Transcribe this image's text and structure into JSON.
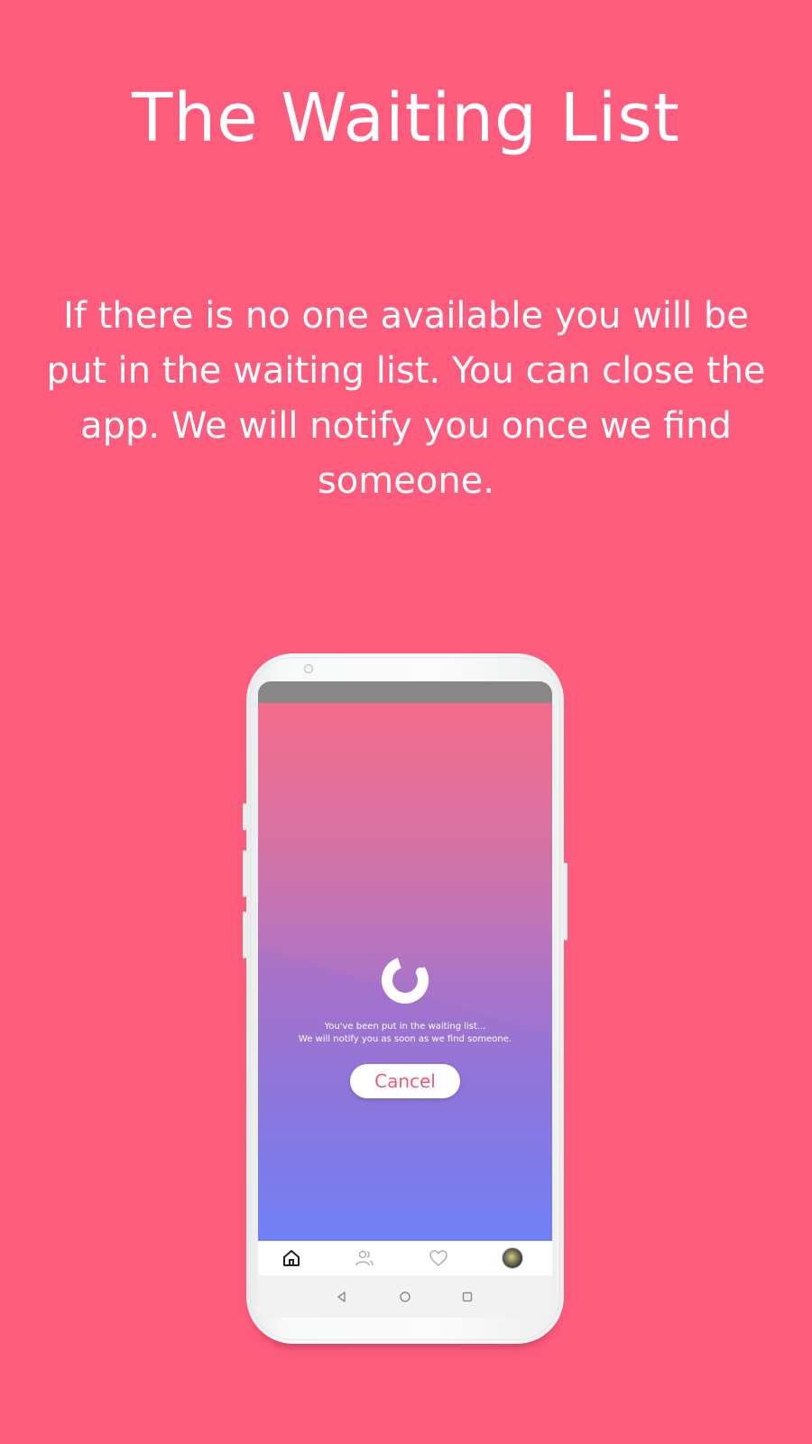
{
  "headline": "The Waiting List",
  "description": "If there is no one available you will be put in the waiting list. You can close the app. We will notify you once we find someone.",
  "app_screen": {
    "message_line_1": "You've been put in the waiting list...",
    "message_line_2": "We will notify you as soon as we find someone.",
    "cancel_label": "Cancel",
    "bottom_nav": [
      {
        "icon": "home-icon",
        "active": true
      },
      {
        "icon": "people-icon",
        "active": false
      },
      {
        "icon": "heart-icon",
        "active": false
      },
      {
        "icon": "profile-avatar",
        "active": false
      }
    ],
    "system_nav": [
      "back-icon",
      "home-circle-icon",
      "recents-icon"
    ]
  },
  "colors": {
    "background": "#fe5c7c",
    "gradient_top": "#f56c8b",
    "gradient_bottom": "#6c84fb",
    "cancel_text": "#f2577a",
    "status_bar": "#888888"
  }
}
